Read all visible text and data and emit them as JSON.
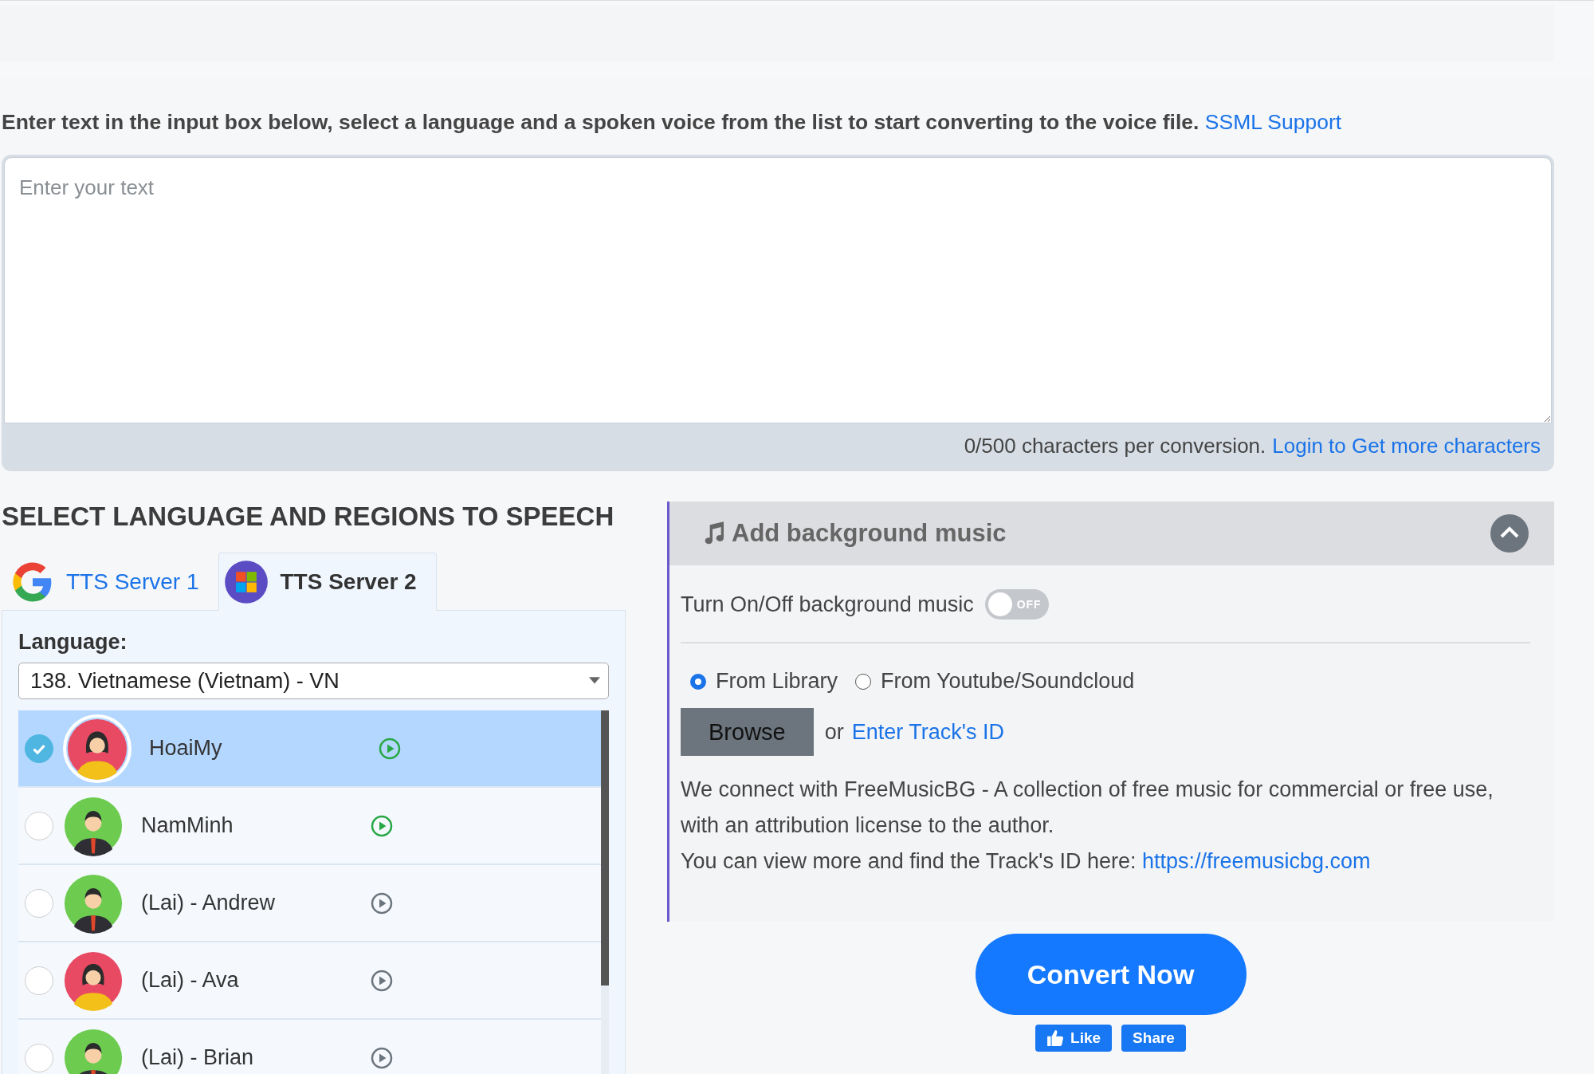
{
  "intro": {
    "text": "Enter text in the input box below, select a language and a spoken voice from the list to start converting to the voice file.",
    "link": "SSML Support"
  },
  "editor": {
    "placeholder": "Enter your text",
    "counter": "0/500 characters per conversion.",
    "login_link": "Login to Get more characters"
  },
  "section_title": "SELECT LANGUAGE AND REGIONS TO SPEECH",
  "tabs": [
    {
      "label": "TTS Server 1",
      "kind": "google",
      "selected": false
    },
    {
      "label": "TTS Server 2",
      "kind": "windows",
      "selected": true
    }
  ],
  "language": {
    "label": "Language:",
    "value": "138. Vietnamese (Vietnam) - VN"
  },
  "voices": [
    {
      "name": "HoaiMy",
      "kind": "female",
      "selected": true,
      "preview_ready": true
    },
    {
      "name": "NamMinh",
      "kind": "male",
      "selected": false,
      "preview_ready": true
    },
    {
      "name": "(Lai) - Andrew",
      "kind": "male",
      "selected": false,
      "preview_ready": false
    },
    {
      "name": "(Lai) - Ava",
      "kind": "female",
      "selected": false,
      "preview_ready": false
    },
    {
      "name": "(Lai) - Brian",
      "kind": "male",
      "selected": false,
      "preview_ready": false
    }
  ],
  "music": {
    "title": "Add background music",
    "expanded": true,
    "toggle_label": "Turn On/Off background music",
    "toggle": {
      "on": false,
      "text": "OFF"
    },
    "sources": [
      {
        "label": "From Library",
        "selected": true
      },
      {
        "label": "From Youtube/Soundcloud",
        "selected": false
      }
    ],
    "browse": "Browse",
    "or": "or",
    "track_link": "Enter Track's ID",
    "description": "We connect with FreeMusicBG - A collection of free music for commercial or free use, with an attribution license to the author.",
    "find_text": "You can view more and find the Track's ID here:",
    "find_link": "https://freemusicbg.com"
  },
  "convert": "Convert Now",
  "like": "Like",
  "share": "Share"
}
